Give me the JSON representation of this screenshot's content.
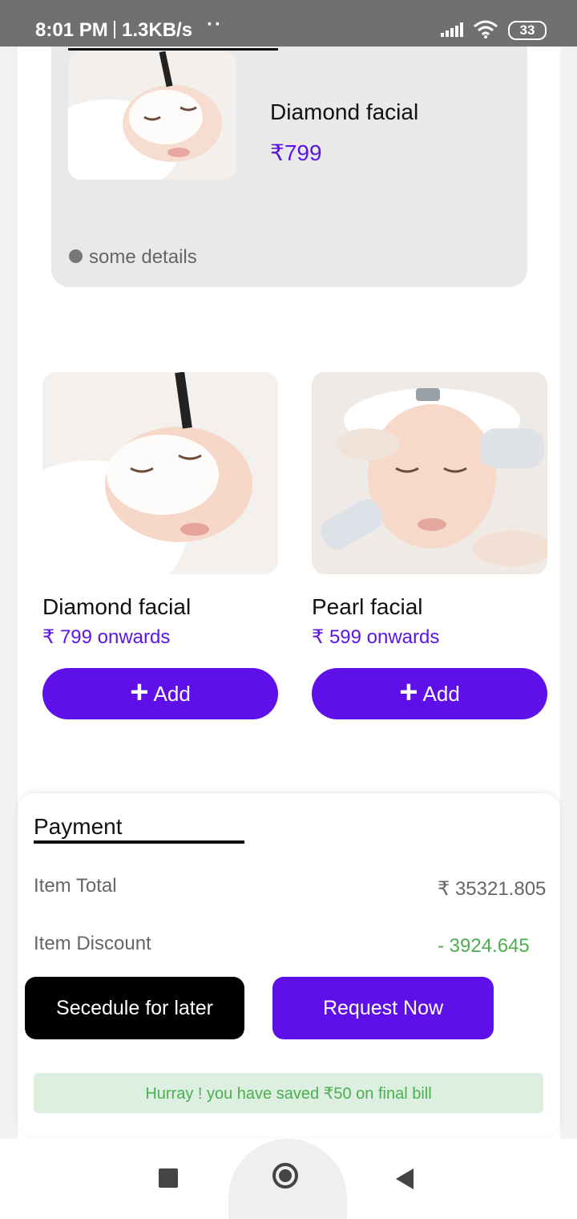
{
  "status_bar": {
    "time": "8:01 PM",
    "net_speed": "1.3KB/s",
    "dots": "··",
    "battery": "33"
  },
  "hero": {
    "title": "Diamond facial",
    "price": "₹799",
    "details": "some details"
  },
  "services": [
    {
      "title": "Diamond facial",
      "price": "₹ 799 onwards",
      "add_label": "Add"
    },
    {
      "title": "Pearl facial",
      "price": "₹ 599 onwards",
      "add_label": "Add"
    }
  ],
  "payment": {
    "title": "Payment",
    "item_total_label": "Item Total",
    "item_total_value": "₹ 35321.805",
    "item_discount_label": "Item Discount",
    "item_discount_value": "- 3924.645",
    "schedule_label": "Secedule for later",
    "request_label": "Request Now",
    "savings_text": "Hurray ! you have saved ₹50 on final bill"
  },
  "colors": {
    "accent": "#5f10e8",
    "price": "#5d15e3",
    "discount": "#4caf50",
    "savings_bg": "#dcefe0"
  }
}
